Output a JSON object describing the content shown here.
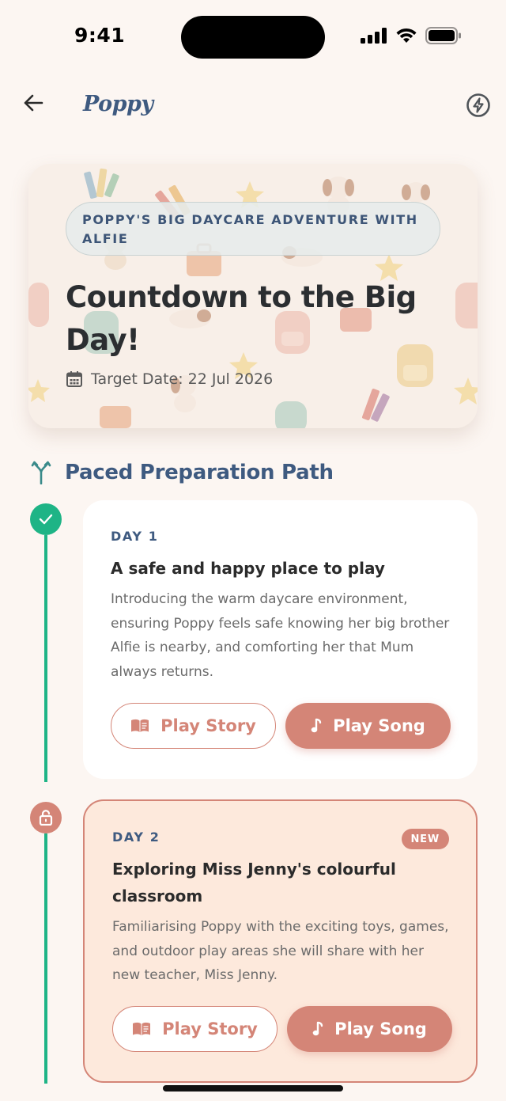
{
  "status_bar": {
    "time": "9:41"
  },
  "header": {
    "app_name": "Poppy"
  },
  "hero": {
    "tag": "POPPY'S BIG DAYCARE ADVENTURE WITH ALFIE",
    "title": "Countdown to the Big Day!",
    "date_label": "Target Date: 22 Jul 2026"
  },
  "section": {
    "title": "Paced Preparation Path"
  },
  "days": [
    {
      "day": "DAY 1",
      "title": "A safe and happy place to play",
      "description": "Introducing the warm daycare environment, ensuring Poppy feels safe knowing her big brother Alfie is nearby, and comforting her that Mum always returns.",
      "status": "completed",
      "story_label": "Play Story",
      "song_label": "Play Song"
    },
    {
      "day": "DAY 2",
      "badge": "NEW",
      "title": "Exploring Miss Jenny's colourful classroom",
      "description": "Familiarising Poppy with the exciting toys, games, and outdoor play areas she will share with her new teacher, Miss Jenny.",
      "status": "locked",
      "story_label": "Play Story",
      "song_label": "Play Song"
    }
  ],
  "colors": {
    "background": "#fcf6f2",
    "accent": "#d48577",
    "navy": "#3e5a80",
    "success": "#1eb486",
    "highlight_card": "#fde9dc"
  }
}
